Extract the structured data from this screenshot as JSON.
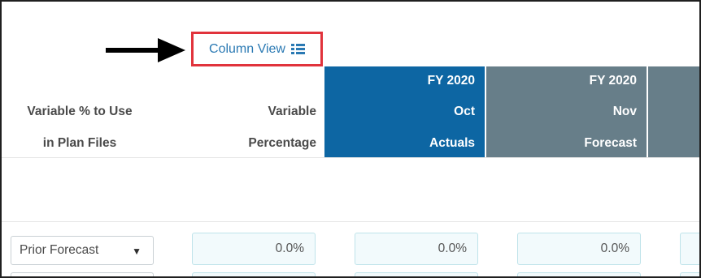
{
  "toolbar": {
    "column_view_label": "Column View",
    "column_view_icon": "list-view-icon",
    "highlight_color": "#e1333c",
    "link_color": "#2a79b3"
  },
  "annotation": {
    "arrow_icon": "right-arrow-icon"
  },
  "table": {
    "headers": {
      "variable_use": [
        "Variable % to Use",
        "in Plan Files"
      ],
      "variable_percentage": [
        "Variable",
        "Percentage"
      ]
    },
    "periods": [
      {
        "year": "FY 2020",
        "month": "Oct",
        "type": "Actuals",
        "color": "#0d66a3"
      },
      {
        "year": "FY 2020",
        "month": "Nov",
        "type": "Forecast",
        "color": "#677e89"
      }
    ],
    "rows": [
      {
        "variable_use": "Prior Forecast",
        "values": [
          "0.0%",
          "0.0%",
          "0.0%"
        ]
      }
    ]
  }
}
